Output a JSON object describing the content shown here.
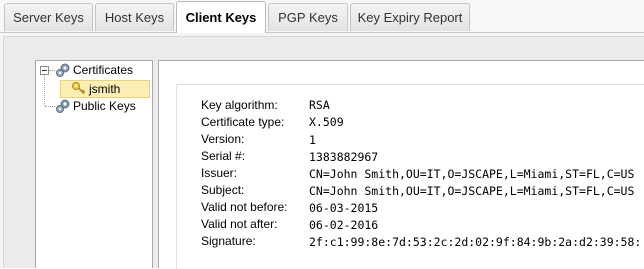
{
  "tabs": [
    {
      "label": "Server Keys",
      "active": false
    },
    {
      "label": "Host Keys",
      "active": false
    },
    {
      "label": "Client Keys",
      "active": true
    },
    {
      "label": "PGP Keys",
      "active": false
    },
    {
      "label": "Key Expiry Report",
      "active": false
    }
  ],
  "tree": {
    "certificates": "Certificates",
    "selected_item": "jsmith",
    "public_keys": "Public Keys"
  },
  "details": [
    {
      "label": "Key algorithm:",
      "value": "RSA"
    },
    {
      "label": "Certificate type:",
      "value": "X.509"
    },
    {
      "label": "Version:",
      "value": "1"
    },
    {
      "label": "Serial #:",
      "value": "1383882967"
    },
    {
      "label": "Issuer:",
      "value": "CN=John Smith,OU=IT,O=JSCAPE,L=Miami,ST=FL,C=US"
    },
    {
      "label": "Subject:",
      "value": "CN=John Smith,OU=IT,O=JSCAPE,L=Miami,ST=FL,C=US"
    },
    {
      "label": "Valid not before:",
      "value": "06-03-2015"
    },
    {
      "label": "Valid not after:",
      "value": "06-02-2016"
    },
    {
      "label": "Signature:",
      "value": "2f:c1:99:8e:7d:53:2c:2d:02:9f:84:9b:2a:d2:39:58:"
    }
  ],
  "colors": {
    "selection": "#fcefb5",
    "tab_active_bg": "#ffffff",
    "panel_bg": "#f4f4f4"
  }
}
